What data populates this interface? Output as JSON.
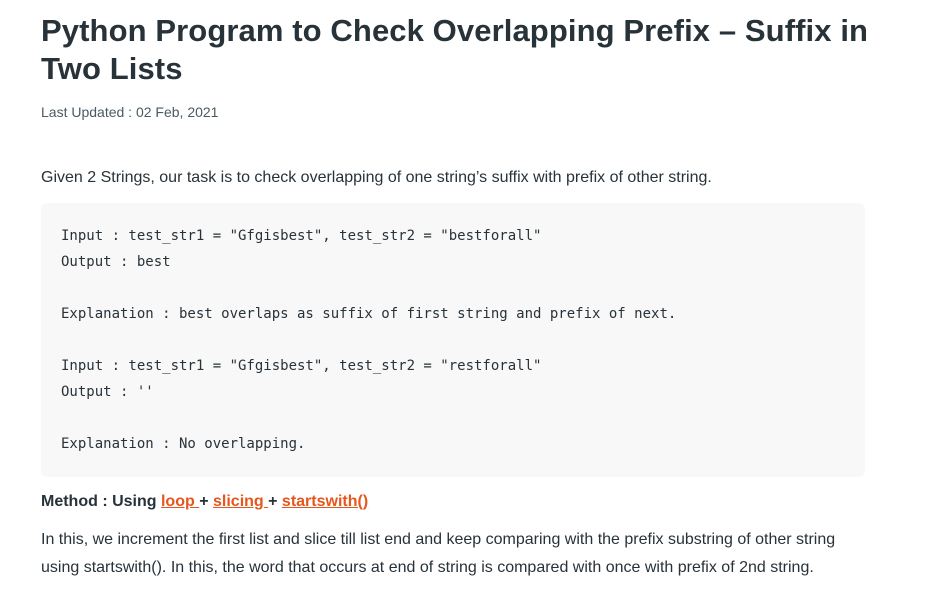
{
  "article": {
    "title": "Python Program to Check Overlapping Prefix – Suffix in Two Lists",
    "last_updated": "Last Updated : 02 Feb, 2021",
    "intro": "Given 2 Strings, our task is to check overlapping of one string’s suffix with prefix of other string.",
    "code_lines": [
      "Input : test_str1 = \"Gfgisbest\", test_str2 = \"bestforall\"",
      "Output : best",
      "",
      "Explanation : best overlaps as suffix of first string and prefix of next.",
      "",
      "Input : test_str1 = \"Gfgisbest\", test_str2 = \"restforall\"",
      "Output : ''",
      "",
      "Explanation : No overlapping."
    ],
    "method": {
      "prefix": "Method : Using ",
      "link_loop": "loop ",
      "plus1": " + ",
      "link_slicing": "slicing ",
      "plus2": " + ",
      "link_startswith": "startswith()"
    },
    "description": "In this, we increment the first list and slice till list end and keep comparing with the prefix substring of other string using startswith(). In this, the word that occurs at end of string is compared with once with prefix of 2nd string."
  },
  "colors": {
    "text": "#273239",
    "link": "#e6561d",
    "code_bg": "#f8f8f8"
  }
}
